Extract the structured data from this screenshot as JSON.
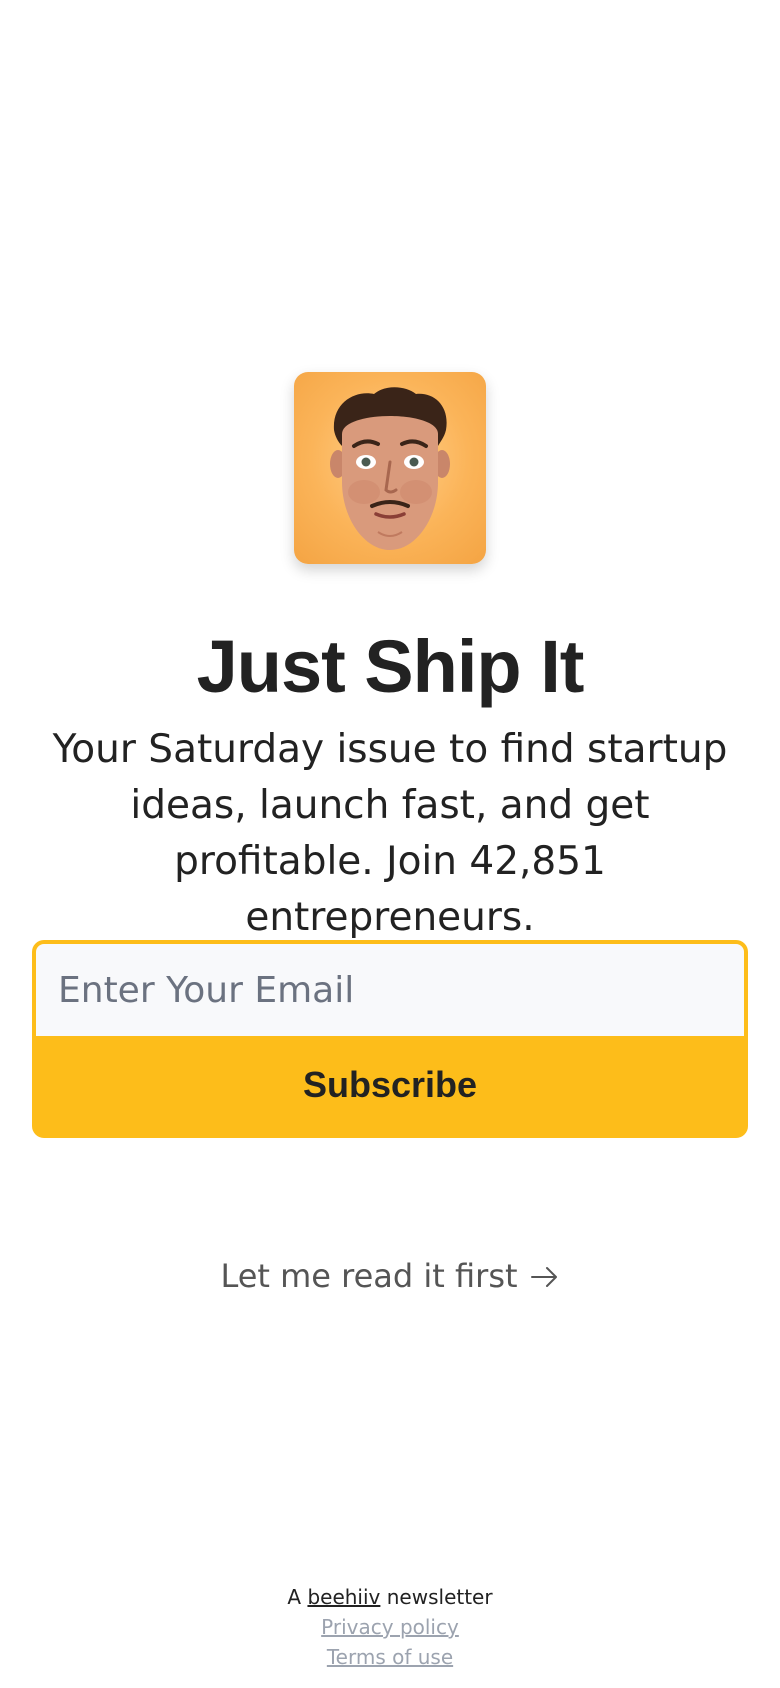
{
  "brand": {
    "logo_icon": "face-avatar-icon",
    "background_color": "#fbb459"
  },
  "header": {
    "title": "Just Ship It"
  },
  "tagline": {
    "text": "Your Saturday issue to find startup ideas, launch fast, and get profitable. Join 42,851 entrepreneurs."
  },
  "subscribe_form": {
    "email_placeholder": "Enter Your Email",
    "email_value": "",
    "button_label": "Subscribe",
    "accent_color": "#fdbd1a"
  },
  "read_first": {
    "label": "Let me read it first",
    "icon": "arrow-right-icon"
  },
  "footer": {
    "prefix": "A",
    "platform_link": "beehiiv",
    "suffix": "newsletter",
    "privacy_label": "Privacy policy",
    "terms_label": "Terms of use"
  }
}
